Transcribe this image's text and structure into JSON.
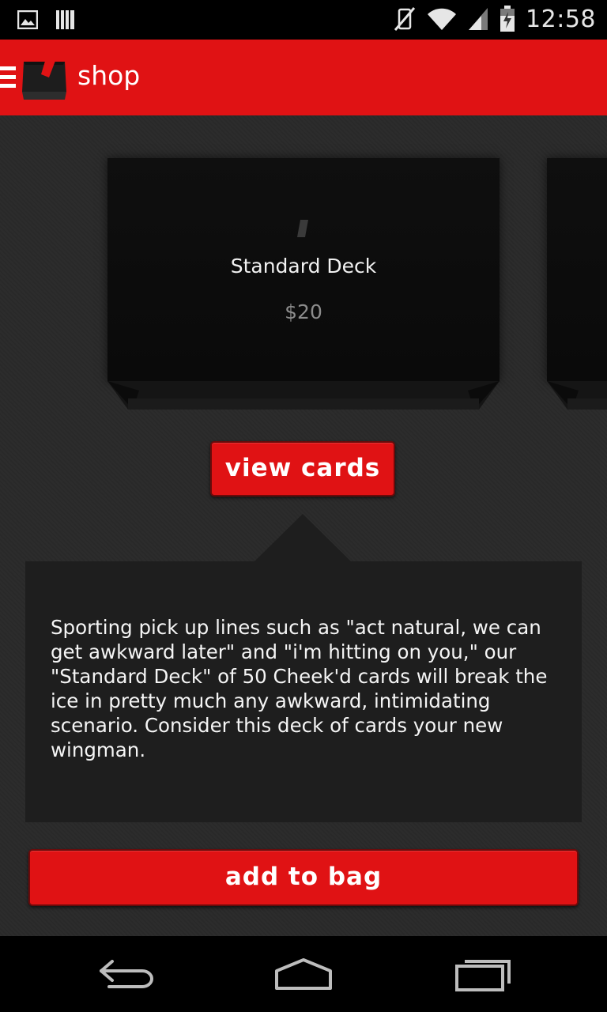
{
  "status_bar": {
    "time": "12:58",
    "icons": [
      "image-notification-icon",
      "barcode-notification-icon",
      "vibrate-off-icon",
      "wifi-icon",
      "signal-icon",
      "battery-icon"
    ]
  },
  "app_bar": {
    "title": "shop",
    "icons": [
      "menu-icon",
      "deck-logo-icon"
    ]
  },
  "carousel": {
    "current": {
      "name": "Standard Deck",
      "price": "$20"
    }
  },
  "actions": {
    "view_cards": "view cards",
    "add_to_bag": "add to bag"
  },
  "description": "Sporting pick up lines such as \"act natural, we can get awkward later\" and \"i'm hitting on you,\" our \"Standard Deck\" of 50 Cheek'd cards will break the ice in pretty much any awkward, intimidating scenario.  Consider this deck of cards your new wingman.",
  "nav_bar": {
    "icons": [
      "back-icon",
      "home-icon",
      "recent-apps-icon"
    ]
  },
  "colors": {
    "accent": "#e01214",
    "background": "#2a2a2a",
    "panel": "#1e1e1e"
  }
}
